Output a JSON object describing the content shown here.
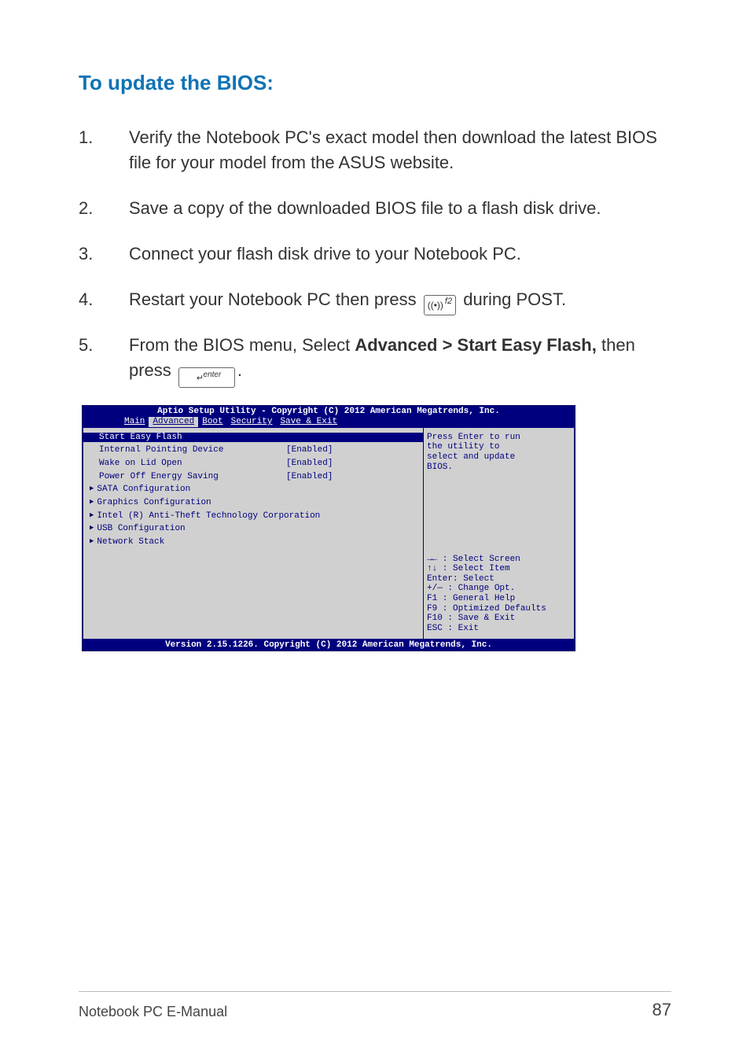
{
  "title": "To update the BIOS:",
  "steps": {
    "s1": {
      "num": "1.",
      "text": "Verify the Notebook PC's exact model then download the latest BIOS file for your model from the ASUS website."
    },
    "s2": {
      "num": "2.",
      "text": "Save a copy of the downloaded BIOS file to a flash disk drive."
    },
    "s3": {
      "num": "3.",
      "text": "Connect your flash disk drive to your Notebook PC."
    },
    "s4": {
      "num": "4.",
      "pre": "Restart your Notebook PC then press ",
      "post": " during POST."
    },
    "s5": {
      "num": "5.",
      "pre": "From the BIOS menu, Select ",
      "bold": "Advanced > Start Easy Flash,",
      "mid": " then press ",
      "period": "."
    }
  },
  "keys": {
    "f2_wifi": "((•))",
    "f2_label": "f2",
    "enter_label": "enter",
    "enter_arrow": "↵"
  },
  "bios": {
    "header": "Aptio Setup Utility - Copyright (C) 2012 American Megatrends, Inc.",
    "tabs": {
      "t1": "Main",
      "t2": "Advanced",
      "t3": "Boot",
      "t4": "Security",
      "t5": "Save & Exit"
    },
    "rows": {
      "sel": "Start Easy Flash",
      "r1": {
        "label": "Internal Pointing Device",
        "val": "[Enabled]"
      },
      "r2": {
        "label": "Wake on Lid Open",
        "val": "[Enabled]"
      },
      "r3": {
        "label": "Power Off Energy Saving",
        "val": "[Enabled]"
      },
      "r4": "SATA Configuration",
      "r5": "Graphics Configuration",
      "r6": "Intel (R) Anti-Theft Technology Corporation",
      "r7": "USB Configuration",
      "r8": "Network Stack"
    },
    "help": {
      "l1": "Press Enter to run",
      "l2": "the utility to",
      "l3": "select and update",
      "l4": "BIOS."
    },
    "legend": {
      "l1": "→←  : Select Screen",
      "l2": "↑↓  : Select Item",
      "l3": "Enter: Select",
      "l4": "+/—  : Change Opt.",
      "l5": "F1   : General Help",
      "l6": "F9   : Optimized Defaults",
      "l7": "F10  : Save & Exit",
      "l8": "ESC  : Exit"
    },
    "footer": "Version 2.15.1226. Copyright (C) 2012 American Megatrends, Inc."
  },
  "footer": {
    "label": "Notebook PC E-Manual",
    "page": "87"
  }
}
